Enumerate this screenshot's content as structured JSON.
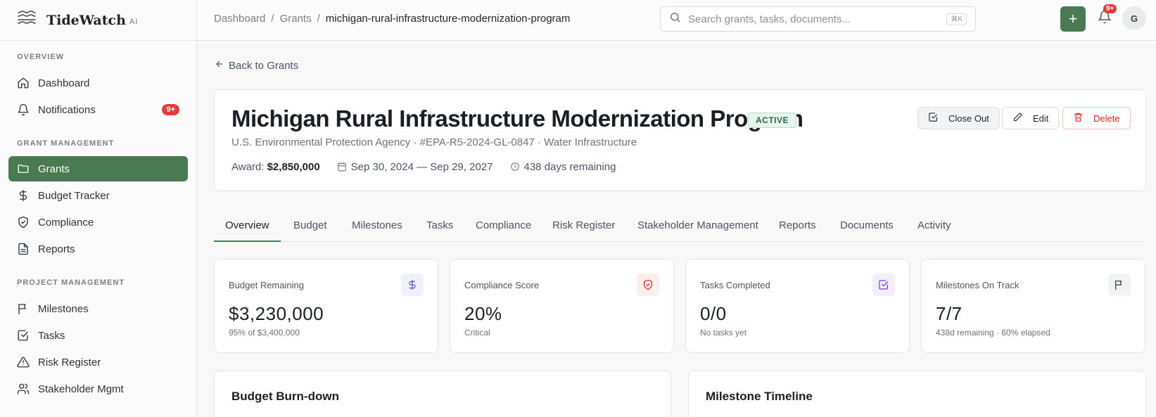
{
  "brand": {
    "name": "TideWatch",
    "suffix": "AI"
  },
  "sidebar": {
    "sections": [
      "OVERVIEW",
      "GRANT MANAGEMENT",
      "PROJECT MANAGEMENT"
    ],
    "items": [
      {
        "label": "Dashboard",
        "icon": "home-icon"
      },
      {
        "label": "Notifications",
        "icon": "bell-icon",
        "badge": "9+"
      },
      {
        "label": "Grants",
        "icon": "folder-icon",
        "active": true
      },
      {
        "label": "Budget Tracker",
        "icon": "dollar-icon"
      },
      {
        "label": "Compliance",
        "icon": "shield-icon"
      },
      {
        "label": "Reports",
        "icon": "document-icon"
      },
      {
        "label": "Milestones",
        "icon": "flag-icon"
      },
      {
        "label": "Tasks",
        "icon": "checkbox-icon"
      },
      {
        "label": "Risk Register",
        "icon": "warning-icon"
      },
      {
        "label": "Stakeholder Mgmt",
        "icon": "users-icon"
      }
    ]
  },
  "topbar": {
    "breadcrumbs": [
      "Dashboard",
      "Grants",
      "michigan-rural-infrastructure-modernization-program"
    ],
    "search_placeholder": "Search grants, tasks, documents...",
    "shortcut": "⌘K",
    "notif_badge": "9+",
    "avatar_initial": "G"
  },
  "back_label": "Back to Grants",
  "grant": {
    "title": "Michigan Rural Infrastructure Modernization Program",
    "status": "ACTIVE",
    "agency": "U.S. Environmental Protection Agency",
    "number": "#EPA-R5-2024-GL-0847",
    "category": "Water Infrastructure",
    "award_label": "Award:",
    "award_value": "$2,850,000",
    "dates": "Sep 30, 2024 — Sep 29, 2027",
    "remaining": "438 days remaining"
  },
  "actions": {
    "close_out": "Close Out",
    "edit": "Edit",
    "delete": "Delete"
  },
  "tabs": [
    "Overview",
    "Budget",
    "Milestones",
    "Tasks",
    "Compliance",
    "Risk Register",
    "Stakeholder Management",
    "Reports",
    "Documents",
    "Activity"
  ],
  "stats": [
    {
      "label": "Budget Remaining",
      "value": "$3,230,000",
      "sub": "95% of $3,400,000",
      "icon": "dollar-icon",
      "color": "#5b57d6",
      "bg": "#eef0fb"
    },
    {
      "label": "Compliance Score",
      "value": "20%",
      "sub": "Critical",
      "icon": "shield-icon",
      "color": "#dc2626",
      "bg": "#fdeeee"
    },
    {
      "label": "Tasks Completed",
      "value": "0/0",
      "sub": "No tasks yet",
      "icon": "checkbox-icon",
      "color": "#7c3aed",
      "bg": "#f3effc"
    },
    {
      "label": "Milestones On Track",
      "value": "7/7",
      "sub": "438d remaining · 60% elapsed",
      "icon": "flag-icon",
      "color": "#374151",
      "bg": "#f1f3f1"
    }
  ],
  "panels": {
    "burndown": "Budget Burn-down",
    "timeline": "Milestone Timeline"
  }
}
